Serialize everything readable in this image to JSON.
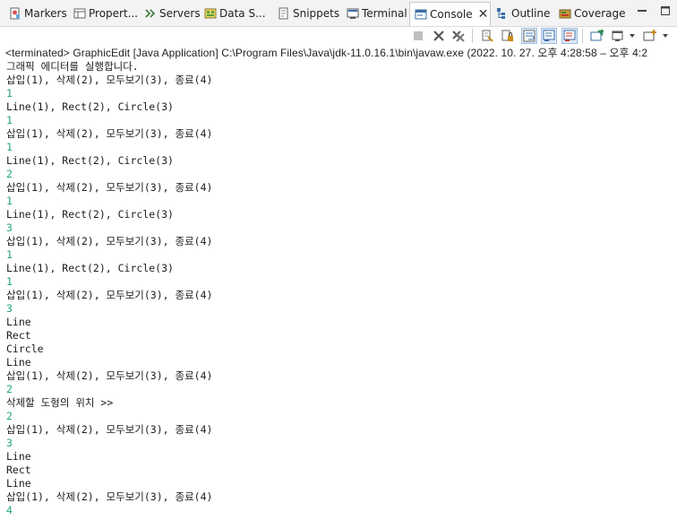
{
  "tabs": [
    {
      "label": "Markers",
      "icon": "markers-icon"
    },
    {
      "label": "Propert...",
      "icon": "properties-icon"
    },
    {
      "label": "Servers",
      "icon": "servers-icon"
    },
    {
      "label": "Data S...",
      "icon": "data-source-icon"
    },
    {
      "label": "Snippets",
      "icon": "snippets-icon"
    },
    {
      "label": "Terminal",
      "icon": "terminal-icon"
    },
    {
      "label": "Console",
      "icon": "console-icon",
      "active": true
    },
    {
      "label": "Outline",
      "icon": "outline-icon"
    },
    {
      "label": "Coverage",
      "icon": "coverage-icon"
    }
  ],
  "status_line": "<terminated> GraphicEdit [Java Application] C:\\Program Files\\Java\\jdk-11.0.16.1\\bin\\javaw.exe  (2022. 10. 27. 오후 4:28:58 – 오후 4:2",
  "console_lines": [
    {
      "text": "그래픽 에디터를 실행합니다.",
      "input": false
    },
    {
      "text": "삽입(1), 삭제(2), 모두보기(3), 종료(4)",
      "input": false
    },
    {
      "text": "1",
      "input": true
    },
    {
      "text": "Line(1), Rect(2), Circle(3)",
      "input": false
    },
    {
      "text": "1",
      "input": true
    },
    {
      "text": "삽입(1), 삭제(2), 모두보기(3), 종료(4)",
      "input": false
    },
    {
      "text": "1",
      "input": true
    },
    {
      "text": "Line(1), Rect(2), Circle(3)",
      "input": false
    },
    {
      "text": "2",
      "input": true
    },
    {
      "text": "삽입(1), 삭제(2), 모두보기(3), 종료(4)",
      "input": false
    },
    {
      "text": "1",
      "input": true
    },
    {
      "text": "Line(1), Rect(2), Circle(3)",
      "input": false
    },
    {
      "text": "3",
      "input": true
    },
    {
      "text": "삽입(1), 삭제(2), 모두보기(3), 종료(4)",
      "input": false
    },
    {
      "text": "1",
      "input": true
    },
    {
      "text": "Line(1), Rect(2), Circle(3)",
      "input": false
    },
    {
      "text": "1",
      "input": true
    },
    {
      "text": "삽입(1), 삭제(2), 모두보기(3), 종료(4)",
      "input": false
    },
    {
      "text": "3",
      "input": true
    },
    {
      "text": "Line",
      "input": false
    },
    {
      "text": "Rect",
      "input": false
    },
    {
      "text": "Circle",
      "input": false
    },
    {
      "text": "Line",
      "input": false
    },
    {
      "text": "삽입(1), 삭제(2), 모두보기(3), 종료(4)",
      "input": false
    },
    {
      "text": "2",
      "input": true
    },
    {
      "text": "삭제할 도형의 위치 >>",
      "input": false
    },
    {
      "text": "2",
      "input": true
    },
    {
      "text": "삽입(1), 삭제(2), 모두보기(3), 종료(4)",
      "input": false
    },
    {
      "text": "3",
      "input": true
    },
    {
      "text": "Line",
      "input": false
    },
    {
      "text": "Rect",
      "input": false
    },
    {
      "text": "Line",
      "input": false
    },
    {
      "text": "삽입(1), 삭제(2), 모두보기(3), 종료(4)",
      "input": false
    },
    {
      "text": "4",
      "input": true
    }
  ],
  "colors": {
    "input_text": "#1fa77a",
    "output_text": "#1c1c1c",
    "tabbar_bg": "#f3f3f3"
  }
}
